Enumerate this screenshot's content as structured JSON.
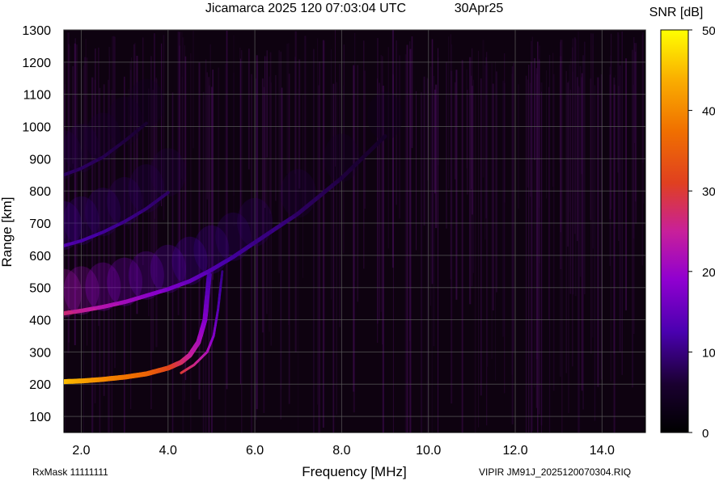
{
  "header": {
    "title": "Jicamarca 2025 120 07:03:04 UTC",
    "date": "30Apr25"
  },
  "footer": {
    "rxmask": "RxMask 11111111",
    "file": "VIPIR  JM91J_2025120070304.RIQ"
  },
  "chart_data": {
    "type": "heatmap",
    "title": "Jicamarca 2025 120 07:03:04 UTC",
    "xlabel": "Frequency [MHz]",
    "ylabel": "Range [km]",
    "xlim": [
      1.6,
      15.0
    ],
    "ylim": [
      50,
      1300
    ],
    "x_ticks": [
      2,
      4,
      6,
      8,
      10,
      12,
      14
    ],
    "x_tick_labels": [
      "2.0",
      "4.0",
      "6.0",
      "8.0",
      "10.0",
      "12.0",
      "14.0"
    ],
    "y_ticks": [
      100,
      200,
      300,
      400,
      500,
      600,
      700,
      800,
      900,
      1000,
      1100,
      1200,
      1300
    ],
    "y_tick_labels": [
      "100",
      "200",
      "300",
      "400",
      "500",
      "600",
      "700",
      "800",
      "900",
      "1000",
      "1100",
      "1200",
      "1300"
    ],
    "grid": true,
    "colorbar": {
      "label": "SNR [dB]",
      "min": 0,
      "max": 50,
      "ticks": [
        0,
        10,
        20,
        30,
        40,
        50
      ],
      "tick_labels": [
        "0",
        "10",
        "20",
        "30",
        "40",
        "50"
      ]
    },
    "traces": [
      {
        "x": [
          1.6,
          2.0,
          2.5,
          3.0,
          3.5,
          4.0,
          4.3,
          4.5,
          4.7,
          4.85,
          4.95
        ],
        "y": [
          208,
          210,
          215,
          222,
          232,
          250,
          268,
          290,
          330,
          400,
          540
        ],
        "snr": [
          45,
          43,
          40,
          38,
          36,
          32,
          28,
          25,
          22,
          18,
          12
        ]
      },
      {
        "x": [
          4.3,
          4.6,
          4.9,
          5.05,
          5.15,
          5.25
        ],
        "y": [
          235,
          260,
          300,
          350,
          430,
          550
        ],
        "snr": [
          30,
          26,
          22,
          18,
          14,
          10
        ]
      },
      {
        "x": [
          1.6,
          2.0,
          2.5,
          3.0,
          3.5,
          4.0,
          4.5,
          5.0,
          5.5,
          6.0,
          7.0,
          8.0,
          9.0
        ],
        "y": [
          420,
          428,
          440,
          455,
          475,
          495,
          520,
          555,
          595,
          640,
          730,
          840,
          970
        ],
        "snr": [
          28,
          26,
          24,
          22,
          20,
          18,
          16,
          14,
          12,
          11,
          9,
          7,
          5
        ]
      },
      {
        "x": [
          1.6,
          2.0,
          2.5,
          3.0,
          3.5,
          4.0
        ],
        "y": [
          630,
          645,
          672,
          705,
          745,
          795
        ],
        "snr": [
          14,
          13,
          12,
          11,
          10,
          9
        ]
      },
      {
        "x": [
          1.6,
          2.0,
          2.5,
          3.0,
          3.5
        ],
        "y": [
          850,
          870,
          905,
          955,
          1010
        ],
        "snr": [
          9,
          9,
          8,
          7,
          6
        ]
      }
    ]
  }
}
